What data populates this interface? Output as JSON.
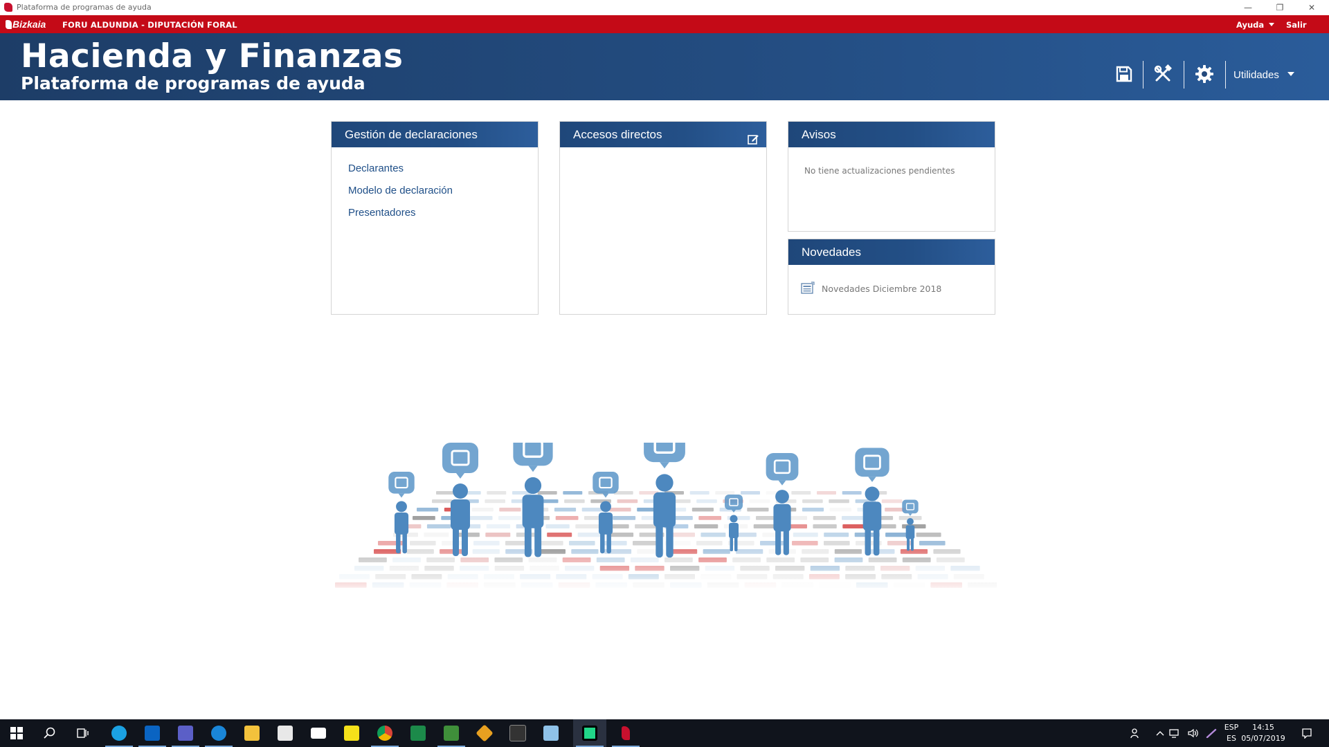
{
  "window": {
    "title": "Plataforma de programas de ayuda",
    "minimize_glyph": "—",
    "restore_glyph": "❐",
    "close_glyph": "✕"
  },
  "topbar": {
    "logo_text": "Bizkaia",
    "org_name": "FORU ALDUNDIA - DIPUTACIÓN FORAL",
    "help_label": "Ayuda",
    "exit_label": "Salir",
    "color": "#c40a17"
  },
  "header": {
    "title": "Hacienda y Finanzas",
    "subtitle": "Plataforma de programas de ayuda",
    "tools": [
      "save-icon",
      "tools-icon",
      "gear-icon"
    ],
    "utilities_label": "Utilidades",
    "color_start": "#1d3d67",
    "color_end": "#2a5c9a"
  },
  "panels": {
    "gestion": {
      "title": "Gestión de declaraciones",
      "links": [
        "Declarantes",
        "Modelo de declaración",
        "Presentadores"
      ]
    },
    "accesos": {
      "title": "Accesos directos",
      "edit_icon": "edit-icon"
    },
    "avisos": {
      "title": "Avisos",
      "message": "No tiene actualizaciones pendientes"
    },
    "novedades": {
      "title": "Novedades",
      "items": [
        "Novedades Diciembre 2018"
      ]
    }
  },
  "taskbar": {
    "apps": [
      "windows-start-icon",
      "search-icon",
      "task-view-icon",
      "skype-icon",
      "outlook-icon",
      "teams-icon",
      "edge-icon",
      "file-explorer-icon",
      "store-icon",
      "mail-icon",
      "sticky-notes-icon",
      "chrome-icon",
      "sourcetree-icon",
      "app-icon",
      "git-icon",
      "terminal-icon",
      "notes-icon",
      "pycharm-icon",
      "bizkaia-app-icon"
    ],
    "language_top": "ESP",
    "language_bottom": "ES",
    "time": "14:15",
    "date": "05/07/2019"
  }
}
